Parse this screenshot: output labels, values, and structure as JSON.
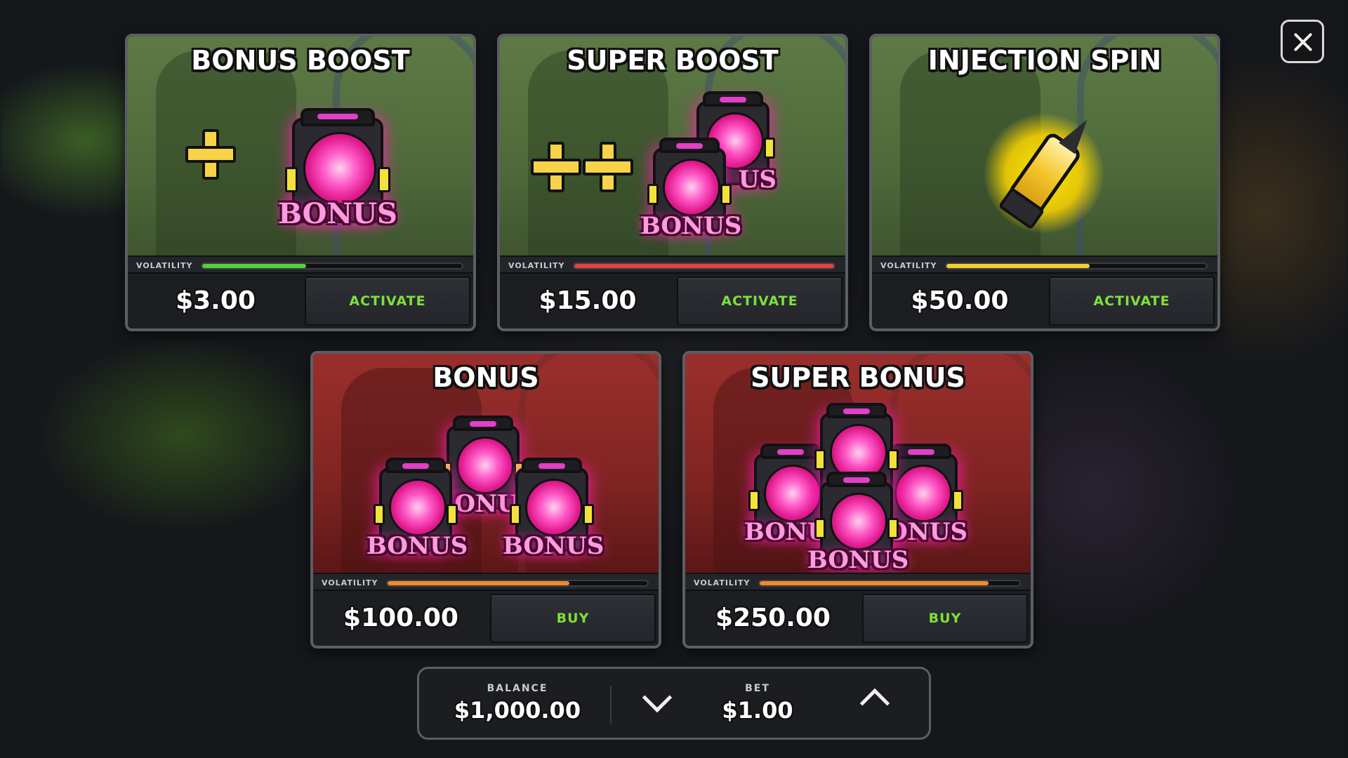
{
  "cards": [
    {
      "title": "BONUS BOOST",
      "volatility_label": "VOLATILITY",
      "volatility": 0.4,
      "volatility_color": "#53d03a",
      "price": "$3.00",
      "button": "ACTIVATE",
      "theme": "green"
    },
    {
      "title": "SUPER BOOST",
      "volatility_label": "VOLATILITY",
      "volatility": 1.0,
      "volatility_color": "#e8413f",
      "price": "$15.00",
      "button": "ACTIVATE",
      "theme": "green"
    },
    {
      "title": "INJECTION SPIN",
      "volatility_label": "VOLATILITY",
      "volatility": 0.55,
      "volatility_color": "#f0d22e",
      "price": "$50.00",
      "button": "ACTIVATE",
      "theme": "green"
    },
    {
      "title": "BONUS",
      "volatility_label": "VOLATILITY",
      "volatility": 0.7,
      "volatility_color": "#f08a2a",
      "price": "$100.00",
      "button": "BUY",
      "theme": "red"
    },
    {
      "title": "SUPER BONUS",
      "volatility_label": "VOLATILITY",
      "volatility": 0.88,
      "volatility_color": "#f08a2a",
      "price": "$250.00",
      "button": "BUY",
      "theme": "red"
    }
  ],
  "chest_label": "BONUS",
  "chest_label_partials": {
    "right_cut": "US",
    "left_cut": "BONU",
    "right_cut2": "ONUS"
  },
  "balance": {
    "label": "BALANCE",
    "value": "$1,000.00"
  },
  "bet": {
    "label": "BET",
    "value": "$1.00"
  },
  "icons": {
    "close": "close-icon",
    "decrease": "chevron-down-icon",
    "increase": "chevron-up-icon"
  },
  "colors": {
    "button_text": "#7ee03a",
    "chest_glow": "#ff1fb0"
  }
}
